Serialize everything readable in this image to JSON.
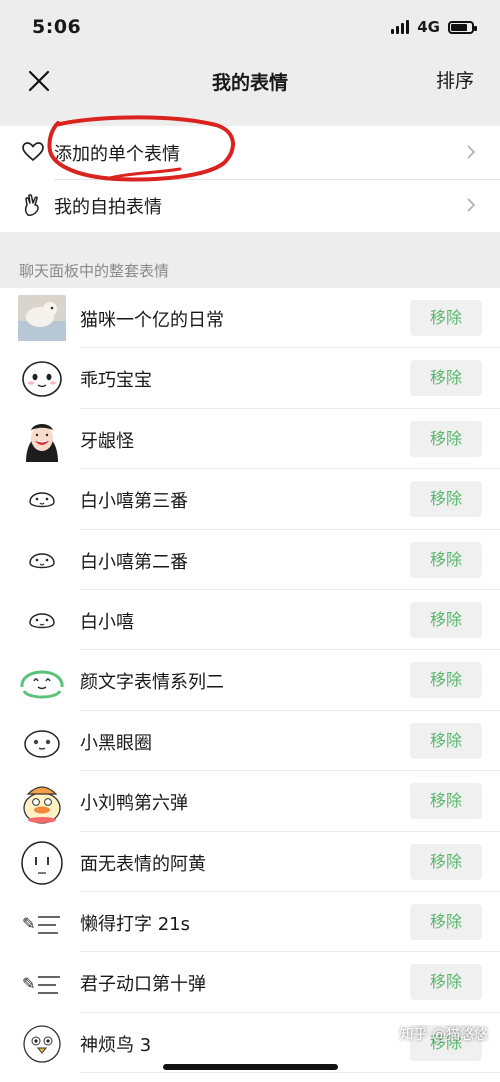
{
  "status": {
    "time": "5:06",
    "network": "4G"
  },
  "nav": {
    "title": "我的表情",
    "sort_label": "排序"
  },
  "top_cells": [
    {
      "label": "添加的单个表情",
      "icon": "heart-icon"
    },
    {
      "label": "我的自拍表情",
      "icon": "selfie-hand-icon"
    }
  ],
  "section_title": "聊天面板中的整套表情",
  "remove_label": "移除",
  "stickers": [
    {
      "name": "猫咪一个亿的日常",
      "icon": "cat-photo-thumbnail"
    },
    {
      "name": "乖巧宝宝",
      "icon": "blob-face-thumbnail"
    },
    {
      "name": "牙龈怪",
      "icon": "smiling-girl-thumbnail"
    },
    {
      "name": "白小嘻第三番",
      "icon": "bai-xiaoxi-thumbnail"
    },
    {
      "name": "白小嘻第二番",
      "icon": "bai-xiaoxi-thumbnail"
    },
    {
      "name": "白小嘻",
      "icon": "bai-xiaoxi-thumbnail"
    },
    {
      "name": "颜文字表情系列二",
      "icon": "kaomoji-thumbnail"
    },
    {
      "name": "小黑眼圈",
      "icon": "dark-circles-thumbnail"
    },
    {
      "name": "小刘鸭第六弹",
      "icon": "duck-thumbnail"
    },
    {
      "name": "面无表情的阿黄",
      "icon": "blank-face-thumbnail"
    },
    {
      "name": "懒得打字 21s",
      "icon": "text-sticker-thumbnail"
    },
    {
      "name": "君子动口第十弹",
      "icon": "text-sticker-thumbnail"
    },
    {
      "name": "神烦鸟 3",
      "icon": "bird-thumbnail"
    }
  ],
  "watermark": "知乎 @猫悠悠"
}
